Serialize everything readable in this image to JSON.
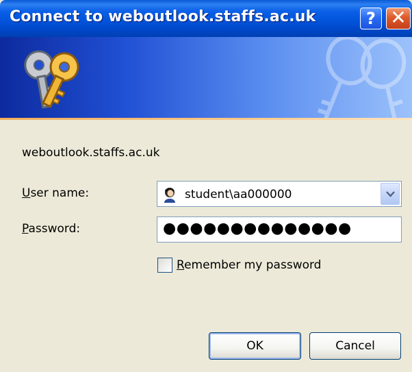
{
  "window": {
    "title": "Connect to weboutlook.staffs.ac.uk",
    "help_glyph": "?",
    "close_glyph": "✕"
  },
  "banner": {
    "icon": "keys-icon"
  },
  "server": "weboutlook.staffs.ac.uk",
  "username": {
    "label_first": "U",
    "label_rest": "ser name:",
    "value": "student\\aa000000",
    "icon": "user-icon"
  },
  "password": {
    "label_first": "P",
    "label_rest": "assword:",
    "masked": "●●●●●●●●●●●●●●"
  },
  "remember": {
    "label_first": "R",
    "label_rest": "emember my password",
    "checked": false
  },
  "buttons": {
    "ok": "OK",
    "cancel": "Cancel"
  },
  "colors": {
    "titlebar": "#0254dc",
    "dialog_bg": "#ece9d8",
    "close_button": "#dd5a2b"
  }
}
